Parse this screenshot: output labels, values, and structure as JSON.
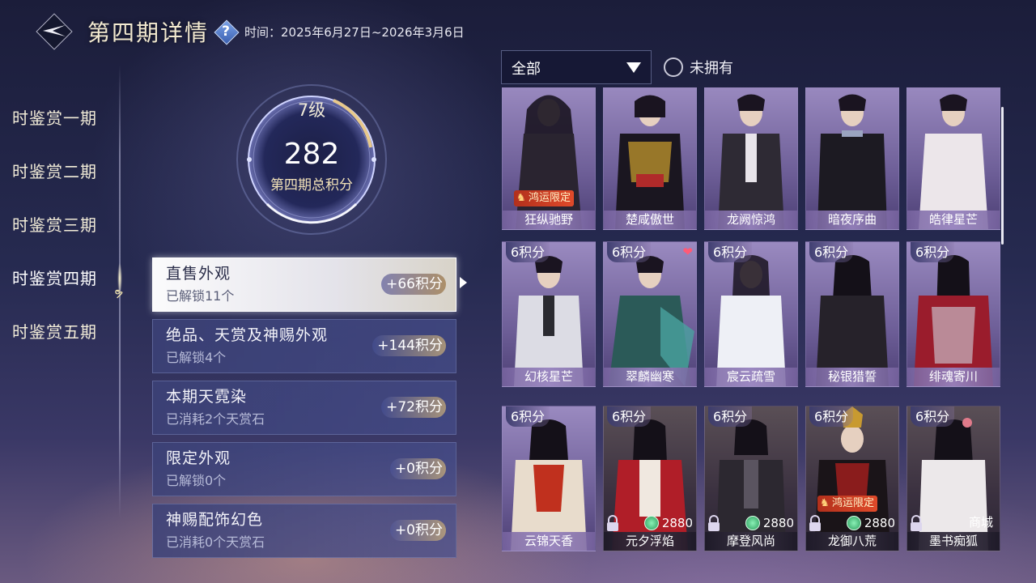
{
  "header": {
    "title": "第四期详情",
    "help_icon": "?",
    "date_range": "时间：2025年6月27日~2026年3月6日"
  },
  "sidebar": {
    "items": [
      {
        "label": "时鉴赏一期",
        "active": false
      },
      {
        "label": "时鉴赏二期",
        "active": false
      },
      {
        "label": "时鉴赏三期",
        "active": false
      },
      {
        "label": "时鉴赏四期",
        "active": true
      },
      {
        "label": "时鉴赏五期",
        "active": false
      }
    ]
  },
  "score": {
    "level": "7级",
    "total": "282",
    "caption": "第四期总积分"
  },
  "categories": [
    {
      "name": "直售外观",
      "sub": "已解锁11个",
      "points": "+66积分",
      "active": true
    },
    {
      "name": "绝品、天赏及神赐外观",
      "sub": "已解锁4个",
      "points": "+144积分",
      "active": false
    },
    {
      "name": "本期天霓染",
      "sub": "已消耗2个天赏石",
      "points": "+72积分",
      "active": false
    },
    {
      "name": "限定外观",
      "sub": "已解锁0个",
      "points": "+0积分",
      "active": false
    },
    {
      "name": "神赐配饰幻色",
      "sub": "已消耗0个天赏石",
      "points": "+0积分",
      "active": false
    }
  ],
  "filter": {
    "selected": "全部",
    "owned_label": "未拥有"
  },
  "cards_row1": [
    {
      "name": "狂纵驰野",
      "limited": "鸿运限定"
    },
    {
      "name": "楚咸傲世"
    },
    {
      "name": "龙阙惊鸿"
    },
    {
      "name": "暗夜序曲"
    },
    {
      "name": "皓律星芒"
    }
  ],
  "cards_row2": [
    {
      "points": "6积分",
      "name": "幻核星芒"
    },
    {
      "points": "6积分",
      "name": "翠麟幽寒"
    },
    {
      "points": "6积分",
      "name": "宸云疏雪"
    },
    {
      "points": "6积分",
      "name": "秘银猎誓"
    },
    {
      "points": "6积分",
      "name": "绯魂寄川"
    }
  ],
  "cards_row3": [
    {
      "points": "6积分",
      "name": "云锦天香"
    },
    {
      "points": "6积分",
      "name": "元夕浮焰",
      "price": "2880"
    },
    {
      "points": "6积分",
      "name": "摩登风尚",
      "price": "2880"
    },
    {
      "points": "6积分",
      "name": "龙御八荒",
      "price": "2880",
      "limited": "鸿运限定"
    },
    {
      "points": "6积分",
      "name": "墨书痴狐",
      "shop": "商城"
    }
  ],
  "colors": {
    "accent_gold": "#f2e2b8",
    "card_lavender": "#9a8ac0",
    "limited_red": "#d0401f",
    "price_coin": "#2a9c5c"
  },
  "icons": {
    "back": "back-arrow-icon",
    "help": "question-icon",
    "dropdown": "triangle-down-icon",
    "lock": "lock-icon",
    "coin": "jade-coin-icon",
    "heart": "heart-icon"
  }
}
